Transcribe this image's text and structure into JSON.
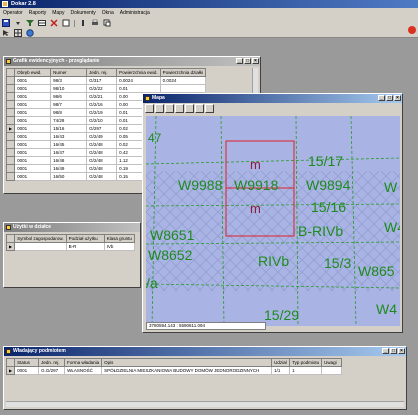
{
  "app": {
    "title": "Dokar 2.8",
    "menu": [
      "Operator",
      "Raporty",
      "Mapy",
      "Dokumenty",
      "Okna",
      "Administracja"
    ]
  },
  "units_window": {
    "title": "Grafik ewidencyjnych - przeglądanie",
    "columns": [
      "Obręb ewid.",
      "Numer",
      "Jedn. rej.",
      "Powierzchnia ewid.",
      "Powierzchnia działki"
    ],
    "rows": [
      [
        "0001",
        "98/3",
        "G/317",
        "0.0024",
        "0.0024"
      ],
      [
        "0001",
        "98/10",
        "G/2/22",
        "0.01",
        ""
      ],
      [
        "0001",
        "98/6",
        "G/2/21",
        "0.00",
        ""
      ],
      [
        "0001",
        "98/7",
        "G/2/16",
        "0.00",
        ""
      ],
      [
        "0001",
        "98/8",
        "G/2/19",
        "0.01",
        ""
      ],
      [
        "0001",
        "74/28",
        "G/2/10",
        "0.01",
        ""
      ],
      [
        "0001",
        "15/16",
        "G/297",
        "0.02",
        ""
      ],
      [
        "0001",
        "16/43",
        "G/2/49",
        "0.05",
        ""
      ],
      [
        "0001",
        "16/45",
        "G/2/48",
        "0.02",
        ""
      ],
      [
        "0001",
        "16/47",
        "G/2/48",
        "0.42",
        ""
      ],
      [
        "0001",
        "16/48",
        "G/2/48",
        "1.12",
        ""
      ],
      [
        "0001",
        "16/49",
        "G/2/48",
        "0.19",
        ""
      ],
      [
        "0001",
        "16/50",
        "G/2/48",
        "0.15",
        ""
      ]
    ],
    "selected_row": 6
  },
  "usage_window": {
    "title": "Użytki w działce",
    "columns": [
      "Symbol zagospodarow.",
      "Podział użytku",
      "Klasa gruntu"
    ],
    "rows": [
      [
        "",
        "B-R",
        "IVb"
      ]
    ]
  },
  "map_window": {
    "title": "Mapa",
    "status": "3780594.143 : 5590611.094",
    "labels": [
      "47",
      "m",
      "15/17",
      "W9988",
      "W9918",
      "W9894",
      "W",
      "m",
      "15/16",
      "W8651",
      "B-RIVb",
      "W4",
      "W8652",
      "RIVb",
      "15/3",
      "W865",
      "/a",
      "15/29",
      "W4"
    ]
  },
  "owners_window": {
    "title": "Władający podmiotem",
    "columns": [
      "Status",
      "Jedn. rej.",
      "Forma władania",
      "Opis",
      "Udział",
      "Typ podmiotu",
      "Uwagi"
    ],
    "rows": [
      [
        "0001",
        "G.G/297",
        "WŁASNOŚĆ",
        "SPÓŁDZIELNIA MIESZKANIOWA BUDOWY DOMÓW JEDNORODZINNYCH",
        "1/1",
        "1",
        ""
      ]
    ]
  },
  "colors": {
    "title_active": "#0a246a",
    "map_bg": "#a9b4e4",
    "map_lines": "#1e8a1e",
    "highlight": "#e0202a"
  }
}
